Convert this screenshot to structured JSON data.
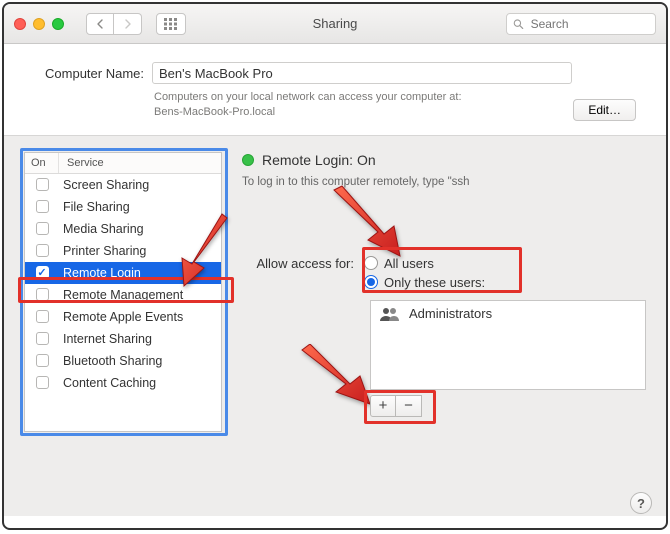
{
  "window": {
    "title": "Sharing",
    "search_placeholder": "Search"
  },
  "computer": {
    "label": "Computer Name:",
    "name": "Ben's MacBook Pro",
    "hint_line1": "Computers on your local network can access your computer at:",
    "hint_line2": "Bens-MacBook-Pro.local",
    "edit_label": "Edit…"
  },
  "services": {
    "col_on": "On",
    "col_service": "Service",
    "items": [
      {
        "label": "Screen Sharing",
        "on": false,
        "selected": false
      },
      {
        "label": "File Sharing",
        "on": false,
        "selected": false
      },
      {
        "label": "Media Sharing",
        "on": false,
        "selected": false
      },
      {
        "label": "Printer Sharing",
        "on": false,
        "selected": false
      },
      {
        "label": "Remote Login",
        "on": true,
        "selected": true
      },
      {
        "label": "Remote Management",
        "on": false,
        "selected": false
      },
      {
        "label": "Remote Apple Events",
        "on": false,
        "selected": false
      },
      {
        "label": "Internet Sharing",
        "on": false,
        "selected": false
      },
      {
        "label": "Bluetooth Sharing",
        "on": false,
        "selected": false
      },
      {
        "label": "Content Caching",
        "on": false,
        "selected": false
      }
    ]
  },
  "detail": {
    "status_label": "Remote Login: On",
    "sub_hint": "To log in to this computer remotely, type \"ssh",
    "access_label": "Allow access for:",
    "radio_all": "All users",
    "radio_only": "Only these users:",
    "selected_radio": "only",
    "users": [
      {
        "label": "Administrators"
      }
    ],
    "plus": "+",
    "minus": "−"
  },
  "help": "?",
  "colors": {
    "accent_blue": "#1767e6",
    "annotation_red": "#e2312a",
    "outline_blue": "#4a8ae8",
    "status_green": "#38c149"
  }
}
